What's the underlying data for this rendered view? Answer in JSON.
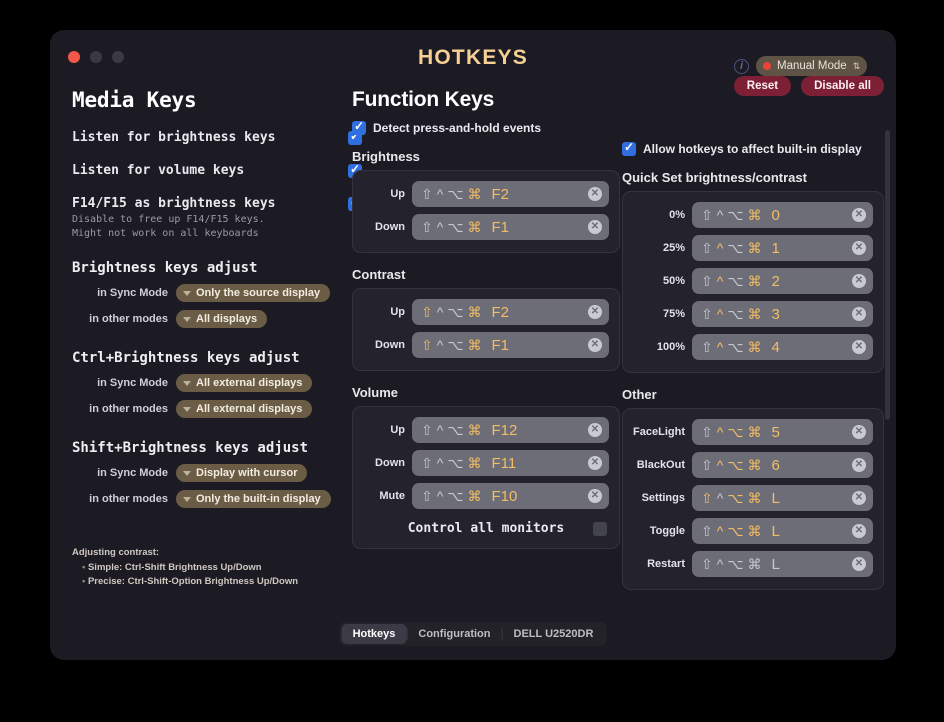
{
  "window": {
    "title": "HOTKEYS",
    "traffic_lights": [
      "close",
      "minimize",
      "maximize"
    ],
    "info_icon": "i",
    "mode": {
      "label": "Manual Mode",
      "dot_color": "#e8443a",
      "chevron": "⇅"
    }
  },
  "left": {
    "heading": "Media Keys",
    "toggles": [
      {
        "label": "Listen for brightness keys",
        "sub": "",
        "checked": true
      },
      {
        "label": "Listen for volume keys",
        "sub": "",
        "checked": true
      },
      {
        "label": "F14/F15 as brightness keys",
        "sub": "Disable to free up F14/F15 keys.\nMight not work on all keyboards",
        "checked": true
      }
    ],
    "groups": [
      {
        "title": "Brightness keys adjust",
        "rows": [
          {
            "label": "in Sync Mode",
            "value": "Only the source display"
          },
          {
            "label": "in other modes",
            "value": "All displays"
          }
        ]
      },
      {
        "title": "Ctrl+Brightness keys adjust",
        "rows": [
          {
            "label": "in Sync Mode",
            "value": "All external displays"
          },
          {
            "label": "in other modes",
            "value": "All external displays"
          }
        ]
      },
      {
        "title": "Shift+Brightness keys adjust",
        "rows": [
          {
            "label": "in Sync Mode",
            "value": "Display with cursor"
          },
          {
            "label": "in other modes",
            "value": "Only the built-in display"
          }
        ]
      }
    ],
    "note": {
      "title": "Adjusting contrast:",
      "lines": [
        "Simple:  Ctrl-Shift Brightness Up/Down",
        "Precise: Ctrl-Shift-Option Brightness Up/Down"
      ]
    }
  },
  "middle": {
    "heading": "Function Keys",
    "detect": {
      "label": "Detect press-and-hold events",
      "checked": true
    },
    "sections": [
      {
        "title": "Brightness",
        "rows": [
          {
            "label": "Up",
            "mods": [
              {
                "g": "⇧",
                "on": false
              },
              {
                "g": "^",
                "on": false
              },
              {
                "g": "⌥",
                "on": false
              },
              {
                "g": "⌘",
                "on": true
              }
            ],
            "key": "F2",
            "key_on": true
          },
          {
            "label": "Down",
            "mods": [
              {
                "g": "⇧",
                "on": false
              },
              {
                "g": "^",
                "on": false
              },
              {
                "g": "⌥",
                "on": false
              },
              {
                "g": "⌘",
                "on": true
              }
            ],
            "key": "F1",
            "key_on": true
          }
        ]
      },
      {
        "title": "Contrast",
        "rows": [
          {
            "label": "Up",
            "mods": [
              {
                "g": "⇧",
                "on": true
              },
              {
                "g": "^",
                "on": false
              },
              {
                "g": "⌥",
                "on": false
              },
              {
                "g": "⌘",
                "on": true
              }
            ],
            "key": "F2",
            "key_on": true
          },
          {
            "label": "Down",
            "mods": [
              {
                "g": "⇧",
                "on": true
              },
              {
                "g": "^",
                "on": false
              },
              {
                "g": "⌥",
                "on": false
              },
              {
                "g": "⌘",
                "on": true
              }
            ],
            "key": "F1",
            "key_on": true
          }
        ]
      },
      {
        "title": "Volume",
        "rows": [
          {
            "label": "Up",
            "mods": [
              {
                "g": "⇧",
                "on": false
              },
              {
                "g": "^",
                "on": false
              },
              {
                "g": "⌥",
                "on": false
              },
              {
                "g": "⌘",
                "on": true
              }
            ],
            "key": "F12",
            "key_on": true
          },
          {
            "label": "Down",
            "mods": [
              {
                "g": "⇧",
                "on": false
              },
              {
                "g": "^",
                "on": false
              },
              {
                "g": "⌥",
                "on": false
              },
              {
                "g": "⌘",
                "on": true
              }
            ],
            "key": "F11",
            "key_on": true
          },
          {
            "label": "Mute",
            "mods": [
              {
                "g": "⇧",
                "on": false
              },
              {
                "g": "^",
                "on": false
              },
              {
                "g": "⌥",
                "on": false
              },
              {
                "g": "⌘",
                "on": true
              }
            ],
            "key": "F10",
            "key_on": true
          }
        ],
        "footer": {
          "label": "Control all monitors",
          "checked": false
        }
      }
    ]
  },
  "right": {
    "allow": {
      "label": "Allow hotkeys to affect built-in display",
      "checked": true
    },
    "buttons": [
      {
        "label": "Reset"
      },
      {
        "label": "Disable all"
      }
    ],
    "sections": [
      {
        "title": "Quick Set brightness/contrast",
        "rows": [
          {
            "label": "0%",
            "mods": [
              {
                "g": "⇧",
                "on": false
              },
              {
                "g": "^",
                "on": false
              },
              {
                "g": "⌥",
                "on": false
              },
              {
                "g": "⌘",
                "on": true
              }
            ],
            "key": "0",
            "key_on": true
          },
          {
            "label": "25%",
            "mods": [
              {
                "g": "⇧",
                "on": false
              },
              {
                "g": "^",
                "on": true
              },
              {
                "g": "⌥",
                "on": false
              },
              {
                "g": "⌘",
                "on": true
              }
            ],
            "key": "1",
            "key_on": true
          },
          {
            "label": "50%",
            "mods": [
              {
                "g": "⇧",
                "on": false
              },
              {
                "g": "^",
                "on": true
              },
              {
                "g": "⌥",
                "on": false
              },
              {
                "g": "⌘",
                "on": true
              }
            ],
            "key": "2",
            "key_on": true
          },
          {
            "label": "75%",
            "mods": [
              {
                "g": "⇧",
                "on": false
              },
              {
                "g": "^",
                "on": true
              },
              {
                "g": "⌥",
                "on": false
              },
              {
                "g": "⌘",
                "on": true
              }
            ],
            "key": "3",
            "key_on": true
          },
          {
            "label": "100%",
            "mods": [
              {
                "g": "⇧",
                "on": false
              },
              {
                "g": "^",
                "on": true
              },
              {
                "g": "⌥",
                "on": false
              },
              {
                "g": "⌘",
                "on": true
              }
            ],
            "key": "4",
            "key_on": true
          }
        ]
      },
      {
        "title": "Other",
        "rows": [
          {
            "label": "FaceLight",
            "mods": [
              {
                "g": "⇧",
                "on": false
              },
              {
                "g": "^",
                "on": true
              },
              {
                "g": "⌥",
                "on": true
              },
              {
                "g": "⌘",
                "on": true
              }
            ],
            "key": "5",
            "key_on": true
          },
          {
            "label": "BlackOut",
            "mods": [
              {
                "g": "⇧",
                "on": false
              },
              {
                "g": "^",
                "on": true
              },
              {
                "g": "⌥",
                "on": true
              },
              {
                "g": "⌘",
                "on": true
              }
            ],
            "key": "6",
            "key_on": true
          },
          {
            "label": "Settings",
            "mods": [
              {
                "g": "⇧",
                "on": true
              },
              {
                "g": "^",
                "on": false
              },
              {
                "g": "⌥",
                "on": true
              },
              {
                "g": "⌘",
                "on": true
              }
            ],
            "key": "L",
            "key_on": true
          },
          {
            "label": "Toggle",
            "mods": [
              {
                "g": "⇧",
                "on": false
              },
              {
                "g": "^",
                "on": true
              },
              {
                "g": "⌥",
                "on": true
              },
              {
                "g": "⌘",
                "on": true
              }
            ],
            "key": "L",
            "key_on": true
          },
          {
            "label": "Restart",
            "mods": [
              {
                "g": "⇧",
                "on": false
              },
              {
                "g": "^",
                "on": false
              },
              {
                "g": "⌥",
                "on": false
              },
              {
                "g": "⌘",
                "on": false
              }
            ],
            "key": "L",
            "key_on": false
          }
        ]
      }
    ],
    "clear_icon": "✕"
  },
  "tabs": [
    {
      "label": "Hotkeys",
      "active": true
    },
    {
      "label": "Configuration",
      "active": false
    },
    {
      "label": "DELL U2520DR",
      "active": false
    }
  ]
}
